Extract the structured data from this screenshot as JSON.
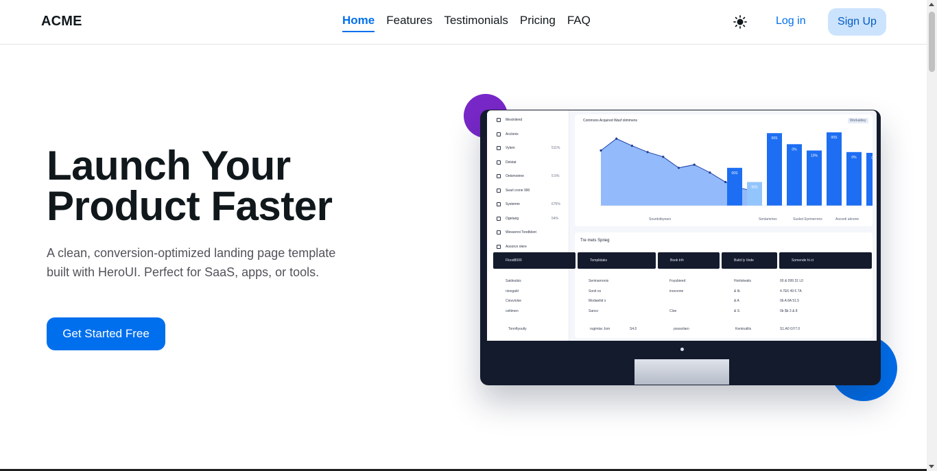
{
  "nav": {
    "brand": "ACME",
    "links": [
      "Home",
      "Features",
      "Testimonials",
      "Pricing",
      "FAQ"
    ],
    "active_link": "Home",
    "login_label": "Log in",
    "signup_label": "Sign Up",
    "theme_icon": "sun-icon"
  },
  "hero": {
    "title_line1": "Launch Your",
    "title_line2": "Product Faster",
    "subtitle": "A clean, conversion-optimized landing page template built with HeroUI. Perfect for SaaS, apps, or tools.",
    "cta_label": "Get Started Free"
  },
  "colors": {
    "primary": "#006fee",
    "secondary": "#7828c8",
    "signup_bg": "#cce3fd",
    "text": "#11181c",
    "muted": "#52525b"
  },
  "mockup": {
    "sidebar_items": [
      {
        "label": "Mestnilend",
        "value": ""
      },
      {
        "label": "Acclonis",
        "value": ""
      },
      {
        "label": "Vylem",
        "value": "511%"
      },
      {
        "label": "Delstat",
        "value": ""
      },
      {
        "label": "Oetsmoinne",
        "value": "5.5%"
      },
      {
        "label": "Searl crone 990",
        "value": ""
      },
      {
        "label": "Systemm",
        "value": "675%"
      },
      {
        "label": "Ogetang",
        "value": "54%"
      },
      {
        "label": "Wessenni Tondblont",
        "value": ""
      },
      {
        "label": "Aosorcn olere",
        "value": ""
      }
    ],
    "chart_title": "Commons Acquired Wasf olimmens",
    "chart_tag": "Workaldey",
    "legend": [
      "Sourdstbyears",
      "Sentammes",
      "Susket Eprmerrens",
      "Ascoeti aknone"
    ],
    "table_title": "Tre mets Sprieg",
    "table_headers": [
      "Flood8000",
      "Tomplidaks",
      "Book trih",
      "Bulid ly Vede",
      "Somende hi ct"
    ],
    "table_rows": [
      [
        "Saidealsis",
        "Seninarnonis",
        "Foyubieed",
        "Hortisteatis",
        "00 & 099 31 L0"
      ],
      [
        "nioogald",
        "Sonit os",
        "inoconne",
        "& lb",
        "4.7E6 49 6 7A"
      ],
      [
        "Cieuviolse",
        "Modaeilid s",
        "",
        "& A",
        "0b A 8A 51.5"
      ],
      [
        "celtimen",
        "Sanco",
        "Cloe",
        "& S",
        "0b $b 3 & 8"
      ]
    ],
    "table_footer": [
      "Tonnftyoutly",
      "rugimtar Jom",
      "S4.0",
      "possoilarn",
      "Kentoutilis",
      "S1.A0 GY7.0"
    ]
  },
  "chart_data": {
    "type": "bar",
    "title": "Commons Acquired Wasf olimmens",
    "bar_values": [
      48,
      30,
      92,
      78,
      70,
      93,
      68,
      67
    ],
    "bar_labels": [
      "00S",
      "60S",
      "00S",
      "0%",
      "10%",
      "00S",
      "0%",
      "0%"
    ],
    "area_values": [
      70,
      85,
      76,
      68,
      62,
      48,
      52,
      42,
      30,
      22,
      18
    ],
    "ylim": [
      0,
      100
    ]
  }
}
